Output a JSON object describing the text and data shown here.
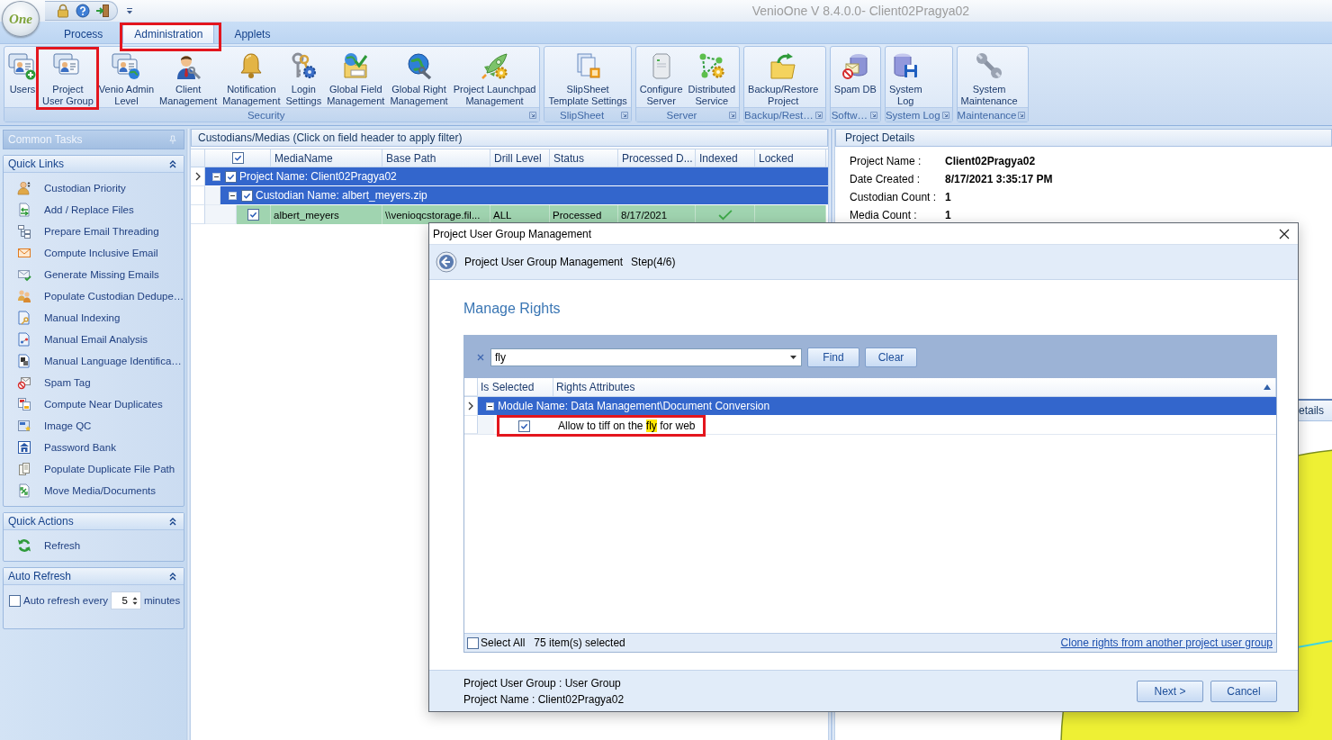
{
  "window": {
    "logo": "One",
    "title": "VenioOne V 8.4.0.0- Client02Pragya02"
  },
  "ribbon_tabs": [
    {
      "label": "Process",
      "selected": false,
      "highlighted": false
    },
    {
      "label": "Administration",
      "selected": true,
      "highlighted": true
    },
    {
      "label": "Applets",
      "selected": false,
      "highlighted": false
    }
  ],
  "ribbon_groups": [
    {
      "title": "Security",
      "buttons": [
        {
          "lines": [
            "Users"
          ],
          "highlighted": false
        },
        {
          "lines": [
            "Project",
            "User Group"
          ],
          "highlighted": true
        },
        {
          "lines": [
            "Venio Admin",
            "Level"
          ],
          "highlighted": false
        },
        {
          "lines": [
            "Client",
            "Management"
          ],
          "highlighted": false
        },
        {
          "lines": [
            "Notification",
            "Management"
          ],
          "highlighted": false
        },
        {
          "lines": [
            "Login",
            "Settings"
          ],
          "highlighted": false
        },
        {
          "lines": [
            "Global Field",
            "Management"
          ],
          "highlighted": false
        },
        {
          "lines": [
            "Global Right",
            "Management"
          ],
          "highlighted": false
        },
        {
          "lines": [
            "Project Launchpad",
            "Management"
          ],
          "highlighted": false
        }
      ]
    },
    {
      "title": "SlipSheet",
      "buttons": [
        {
          "lines": [
            "SlipSheet",
            "Template Settings"
          ],
          "highlighted": false
        }
      ]
    },
    {
      "title": "Server",
      "buttons": [
        {
          "lines": [
            "Configure",
            "Server"
          ],
          "highlighted": false
        },
        {
          "lines": [
            "Distributed",
            "Service"
          ],
          "highlighted": false
        }
      ]
    },
    {
      "title": "Backup/Rest…",
      "buttons": [
        {
          "lines": [
            "Backup/Restore",
            "Project"
          ],
          "highlighted": false
        }
      ]
    },
    {
      "title": "Softw…",
      "buttons": [
        {
          "lines": [
            "Spam DB"
          ],
          "highlighted": false
        }
      ]
    },
    {
      "title": "System Log",
      "buttons": [
        {
          "lines": [
            "System",
            "Log"
          ],
          "highlighted": false
        }
      ]
    },
    {
      "title": "Maintenance",
      "buttons": [
        {
          "lines": [
            "System",
            "Maintenance"
          ],
          "highlighted": false
        }
      ]
    }
  ],
  "sidebar": {
    "title": "Common Tasks",
    "sections": [
      {
        "kind": "links",
        "title": "Quick Links",
        "expanded": true,
        "items": [
          "Custodian Priority",
          "Add / Replace Files",
          "Prepare Email Threading",
          "Compute Inclusive Email",
          "Generate Missing Emails",
          "Populate Custodian Dedupe…",
          "Manual Indexing",
          "Manual Email Analysis",
          "Manual Language Identifica…",
          "Spam Tag",
          "Compute Near Duplicates",
          "Image QC",
          "Password Bank",
          "Populate Duplicate File Path",
          "Move Media/Documents"
        ]
      },
      {
        "kind": "links",
        "title": "Quick Actions",
        "expanded": true,
        "items": [
          "Refresh"
        ]
      },
      {
        "kind": "auto_refresh",
        "title": "Auto Refresh",
        "expanded": true,
        "checked": false,
        "label": "Auto refresh every",
        "value": "5",
        "unit": "minutes"
      }
    ]
  },
  "media_grid": {
    "title": "Custodians/Medias (Click on field header to apply filter)",
    "all_checked": true,
    "columns": [
      "MediaName",
      "Base Path",
      "Drill Level",
      "Status",
      "Processed D...",
      "Indexed",
      "Locked"
    ],
    "projects": [
      {
        "label": "Project Name: Client02Pragya02",
        "checked": true,
        "expanded": true,
        "focused": true,
        "custodians": [
          {
            "label": "Custodian Name: albert_meyers.zip",
            "checked": true,
            "expanded": true,
            "media": [
              {
                "checked": true,
                "cells": [
                  "albert_meyers",
                  "\\\\venioqcstorage.fil...",
                  "ALL",
                  "Processed",
                  "8/17/2021"
                ],
                "indexed": true
              }
            ]
          }
        ]
      }
    ]
  },
  "project_details": {
    "title": "Project Details",
    "fields": [
      {
        "label": "Project Name :",
        "value": "Client02Pragya02"
      },
      {
        "label": "Date Created :",
        "value": "8/17/2021 3:35:17 PM"
      },
      {
        "label": "Custodian Count :",
        "value": "1"
      },
      {
        "label": "Media Count :",
        "value": "1"
      }
    ]
  },
  "details_panel": {
    "title": "etails"
  },
  "dialog": {
    "title": "Project User Group Management",
    "step_title": "Project User Group Management",
    "step": "Step(4/6)",
    "heading": "Manage Rights",
    "search": {
      "value": "fly"
    },
    "search_buttons": [
      "Find",
      "Clear"
    ],
    "columns": [
      "Is Selected",
      "Rights Attributes"
    ],
    "modules": [
      {
        "label": "Module Name: Data Management\\Document Conversion",
        "expanded": true,
        "focused": true,
        "rights": [
          {
            "checked": true,
            "highlighted": true,
            "segments": [
              {
                "text": "Allow to tiff on the ",
                "match": false
              },
              {
                "text": "fly",
                "match": true
              },
              {
                "text": " for web",
                "match": false
              }
            ]
          }
        ]
      }
    ],
    "select_all": {
      "label": "Select All",
      "checked": false
    },
    "selection_count": "75 item(s) selected",
    "clone_link": "Clone rights from another project user group",
    "summary": [
      "Project User Group : User Group",
      "Project Name : Client02Pragya02"
    ],
    "actions": [
      "Next >",
      "Cancel"
    ]
  }
}
